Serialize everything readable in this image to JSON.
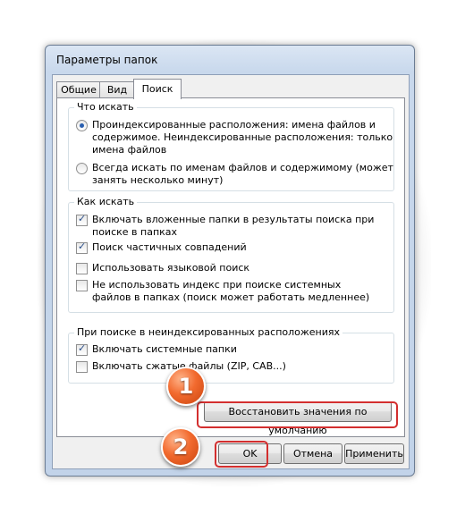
{
  "window": {
    "title": "Параметры папок"
  },
  "tabs": [
    {
      "label": "Общие",
      "active": false
    },
    {
      "label": "Вид",
      "active": false
    },
    {
      "label": "Поиск",
      "active": true
    }
  ],
  "what_to_search": {
    "legend": "Что искать",
    "options": [
      {
        "line1": "Проиндексированные расположения: имена файлов и",
        "line2": "содержимое. Неиндексированные расположения: только",
        "line3": "имена файлов",
        "selected": true
      },
      {
        "line1": "Всегда искать по именам файлов и содержимому (может",
        "line2": "занять несколько минут)",
        "selected": false
      }
    ]
  },
  "how_to_search": {
    "legend": "Как искать",
    "options": [
      {
        "line1": "Включать вложенные папки в результаты поиска при",
        "line2": "поиске в папках",
        "checked": true
      },
      {
        "line1": "Поиск частичных совпадений",
        "checked": true
      },
      {
        "line1": "Использовать языковой поиск",
        "checked": false
      },
      {
        "line1": "Не использовать индекс при поиске системных",
        "line2": "файлов в папках (поиск может работать медленнее)",
        "checked": false
      }
    ]
  },
  "non_indexed": {
    "legend": "При поиске в неиндексированных расположениях",
    "options": [
      {
        "line1": "Включать системные папки",
        "checked": true
      },
      {
        "line1": "Включать сжатые файлы (ZIP, CAB...)",
        "checked": false
      }
    ]
  },
  "buttons": {
    "restore_defaults": "Восстановить значения по умолчанию",
    "ok": "OK",
    "cancel": "Отмена",
    "apply": "Применить"
  },
  "markers": {
    "one": "1",
    "two": "2"
  },
  "colors": {
    "highlight": "#d32f2f",
    "marker": "#f26a2e"
  }
}
